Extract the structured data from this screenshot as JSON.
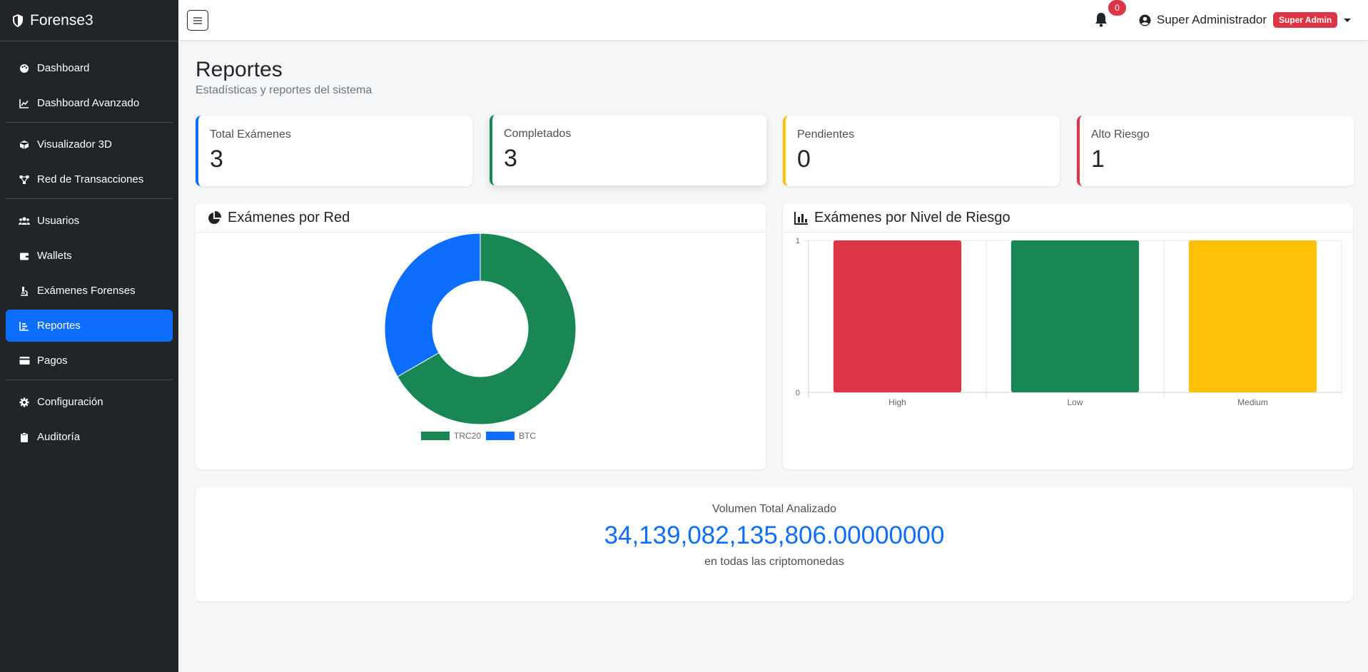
{
  "sidebar": {
    "brand": "Forense3",
    "items": [
      {
        "label": "Dashboard",
        "icon": "palette-icon"
      },
      {
        "label": "Dashboard Avanzado",
        "icon": "line-chart-icon"
      },
      {
        "label": "Visualizador 3D",
        "icon": "cube-icon"
      },
      {
        "label": "Red de Transacciones",
        "icon": "network-icon"
      },
      {
        "label": "Usuarios",
        "icon": "users-icon"
      },
      {
        "label": "Wallets",
        "icon": "wallet-icon"
      },
      {
        "label": "Exámenes Forenses",
        "icon": "microscope-icon"
      },
      {
        "label": "Reportes",
        "icon": "bar-chart-icon",
        "active": true
      },
      {
        "label": "Pagos",
        "icon": "credit-card-icon"
      },
      {
        "label": "Configuración",
        "icon": "gear-icon"
      },
      {
        "label": "Auditoría",
        "icon": "clipboard-icon"
      }
    ]
  },
  "topbar": {
    "notifications": "0",
    "user_name": "Super Administrador",
    "role": "Super Admin"
  },
  "page": {
    "title": "Reportes",
    "subtitle": "Estadísticas y reportes del sistema"
  },
  "stats": [
    {
      "label": "Total Exámenes",
      "value": "3",
      "color": "#0d6efd"
    },
    {
      "label": "Completados",
      "value": "3",
      "color": "#198754"
    },
    {
      "label": "Pendientes",
      "value": "0",
      "color": "#ffc107"
    },
    {
      "label": "Alto Riesgo",
      "value": "1",
      "color": "#dc3545"
    }
  ],
  "cards": {
    "network_title": "Exámenes por Red",
    "risk_title": "Exámenes por Nivel de Riesgo"
  },
  "chart_data": [
    {
      "type": "pie",
      "title": "Exámenes por Red",
      "labels": [
        "TRC20",
        "BTC"
      ],
      "values": [
        2,
        1
      ],
      "colors": [
        "#198754",
        "#0d6efd"
      ],
      "legend": "bottom"
    },
    {
      "type": "bar",
      "title": "Exámenes por Nivel de Riesgo",
      "categories": [
        "High",
        "Low",
        "Medium"
      ],
      "values": [
        1,
        1,
        1
      ],
      "colors": [
        "#dc3545",
        "#198754",
        "#ffc107"
      ],
      "ylim": [
        0,
        1
      ],
      "yticks": [
        "0",
        "1"
      ],
      "grid": true
    }
  ],
  "volume": {
    "label": "Volumen Total Analizado",
    "value": "34,139,082,135,806.00000000",
    "note": "en todas las criptomonedas"
  }
}
